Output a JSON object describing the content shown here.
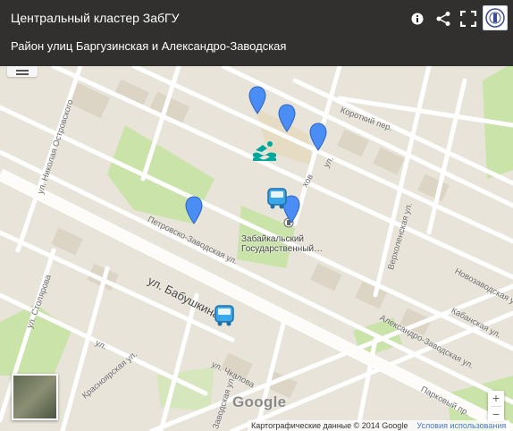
{
  "header": {
    "title": "Центральный кластер ЗабГУ",
    "subtitle": "Район улиц Баргузинская и Александро-Заводская"
  },
  "icons": {
    "info": "info-icon",
    "share": "share-icon",
    "fullscreen": "fullscreen-icon",
    "logo": "university-logo",
    "marker": "map-marker-icon",
    "bus": "bus-stop-icon",
    "swimming": "swimming-pool-icon"
  },
  "map": {
    "streets": {
      "ostrovskogo": "ул. Николая Островского",
      "korotky": "Короткий пер.",
      "verkholenskaya": "Верхоленская ул.",
      "petrovsko": "Петровско-Заводская ул.",
      "babushkina": "ул. Бабушкина",
      "stolyarova": "ул. Столярова",
      "krasnoyarskaya": "Красноярская ул.",
      "novozavodskaya": "Новозаводская ул.",
      "kabanskaya": "Кабанская ул.",
      "aleksandro": "Александро-Заводская ул.",
      "parkovy": "Парковый пр.",
      "chkalova": "ул. Чкалова",
      "zavodskaya": "Заводская ул.",
      "kharaza": "ул.",
      "gl": "ул.",
      "petrovsko2": "Петровско",
      "fragment_left": "ул.",
      "fragment_chov": "хов",
      "fragment_ul": "ул."
    },
    "poi": {
      "line1": "Забайкальский",
      "line2": "Государственный…"
    },
    "google_logo": "Google"
  },
  "attribution": {
    "data": "Картографические данные © 2014 Google",
    "terms": "Условия использования"
  },
  "zoom": {
    "in": "+",
    "out": "−"
  },
  "colors": {
    "header_bg": "#212121",
    "marker": "#4a8ef5",
    "bus": "#3aa7e8",
    "pool": "#00a79d",
    "park": "#c9e3a8"
  }
}
